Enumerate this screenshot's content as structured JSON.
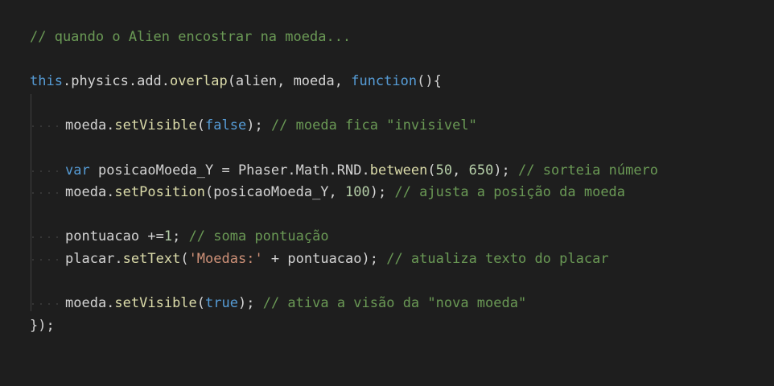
{
  "editor": {
    "theme_background": "#1e1e1e",
    "lines": [
      {
        "id": "l1",
        "indent": false,
        "tokens": [
          {
            "t": "comment",
            "v": "// quando o Alien encostrar na moeda..."
          }
        ]
      },
      {
        "id": "l2",
        "indent": false,
        "tokens": []
      },
      {
        "id": "l3",
        "indent": false,
        "tokens": [
          {
            "t": "keyword",
            "v": "this"
          },
          {
            "t": "plain",
            "v": "."
          },
          {
            "t": "plain",
            "v": "physics.add."
          },
          {
            "t": "func",
            "v": "overlap"
          },
          {
            "t": "plain",
            "v": "(alien, moeda, "
          },
          {
            "t": "keyword",
            "v": "function"
          },
          {
            "t": "plain",
            "v": "(){"
          }
        ]
      },
      {
        "id": "l4",
        "indent": false,
        "tokens": []
      },
      {
        "id": "l5",
        "indent": true,
        "tokens": [
          {
            "t": "plain",
            "v": "moeda."
          },
          {
            "t": "func",
            "v": "setVisible"
          },
          {
            "t": "plain",
            "v": "("
          },
          {
            "t": "keyword",
            "v": "false"
          },
          {
            "t": "plain",
            "v": "); "
          },
          {
            "t": "comment",
            "v": "// moeda fica \"invisivel\""
          }
        ]
      },
      {
        "id": "l6",
        "indent": false,
        "tokens": []
      },
      {
        "id": "l7",
        "indent": true,
        "tokens": [
          {
            "t": "keyword",
            "v": "var"
          },
          {
            "t": "plain",
            "v": " posicaoMoeda_Y = Phaser.Math.RND."
          },
          {
            "t": "func",
            "v": "between"
          },
          {
            "t": "plain",
            "v": "("
          },
          {
            "t": "number",
            "v": "50"
          },
          {
            "t": "plain",
            "v": ", "
          },
          {
            "t": "number",
            "v": "650"
          },
          {
            "t": "plain",
            "v": "); "
          },
          {
            "t": "comment",
            "v": "// sorteia número"
          }
        ]
      },
      {
        "id": "l8",
        "indent": true,
        "tokens": [
          {
            "t": "plain",
            "v": "moeda."
          },
          {
            "t": "func",
            "v": "setPosition"
          },
          {
            "t": "plain",
            "v": "(posicaoMoeda_Y, "
          },
          {
            "t": "number",
            "v": "100"
          },
          {
            "t": "plain",
            "v": "); "
          },
          {
            "t": "comment",
            "v": "// ajusta a posição da moeda"
          }
        ]
      },
      {
        "id": "l9",
        "indent": false,
        "tokens": []
      },
      {
        "id": "l10",
        "indent": true,
        "tokens": [
          {
            "t": "plain",
            "v": "pontuacao +="
          },
          {
            "t": "number",
            "v": "1"
          },
          {
            "t": "plain",
            "v": "; "
          },
          {
            "t": "comment",
            "v": "// soma pontuação"
          }
        ]
      },
      {
        "id": "l11",
        "indent": true,
        "tokens": [
          {
            "t": "plain",
            "v": "placar."
          },
          {
            "t": "func",
            "v": "setText"
          },
          {
            "t": "plain",
            "v": "("
          },
          {
            "t": "string",
            "v": "'Moedas:'"
          },
          {
            "t": "plain",
            "v": " + pontuacao); "
          },
          {
            "t": "comment",
            "v": "// atualiza texto do placar"
          }
        ]
      },
      {
        "id": "l12",
        "indent": false,
        "tokens": []
      },
      {
        "id": "l13",
        "indent": true,
        "tokens": [
          {
            "t": "plain",
            "v": "moeda."
          },
          {
            "t": "func",
            "v": "setVisible"
          },
          {
            "t": "plain",
            "v": "("
          },
          {
            "t": "keyword",
            "v": "true"
          },
          {
            "t": "plain",
            "v": "); "
          },
          {
            "t": "comment",
            "v": "// ativa a visão da \"nova moeda\""
          }
        ]
      },
      {
        "id": "l14",
        "indent": false,
        "tokens": [
          {
            "t": "plain",
            "v": "});"
          }
        ]
      }
    ]
  }
}
